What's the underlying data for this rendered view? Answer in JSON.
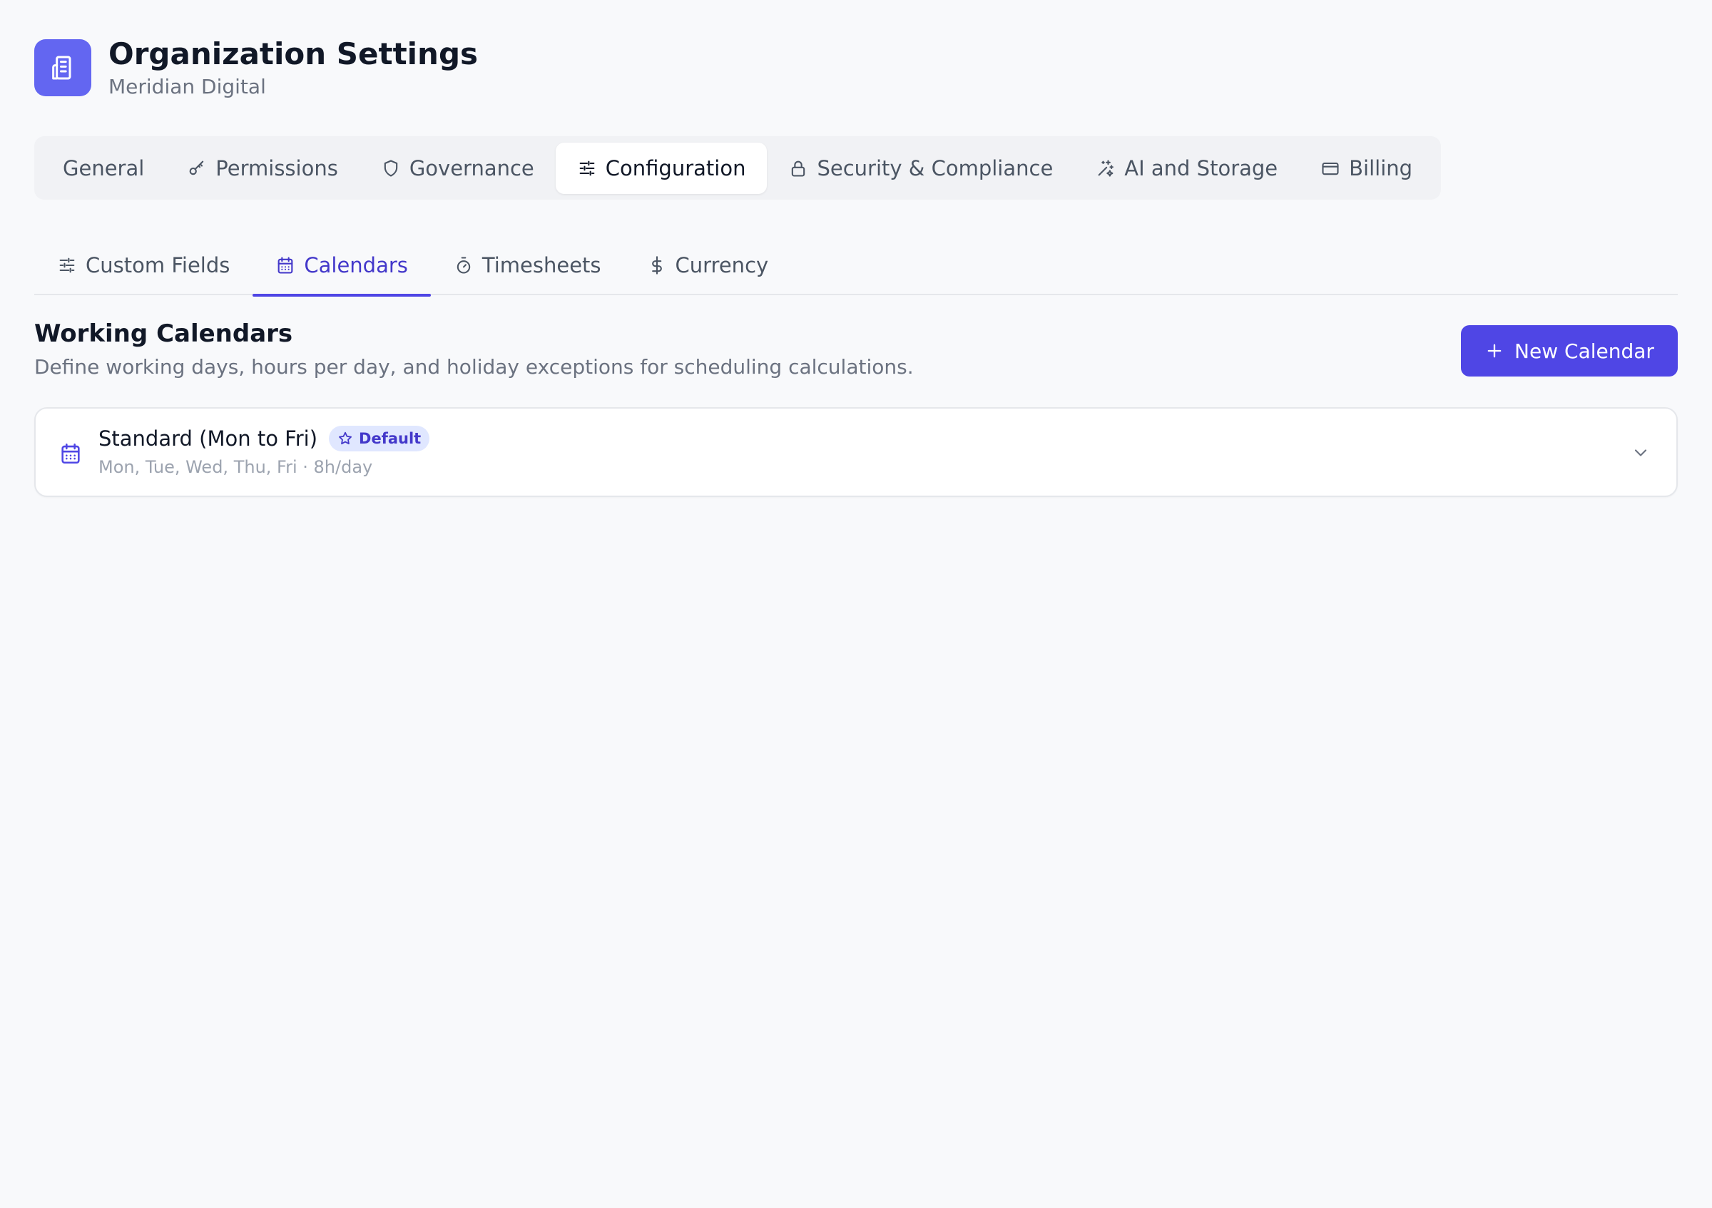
{
  "header": {
    "title": "Organization Settings",
    "subtitle": "Meridian Digital",
    "logo_icon": "building-icon"
  },
  "primary_tabs": [
    {
      "label": "General",
      "icon": null,
      "active": false
    },
    {
      "label": "Permissions",
      "icon": "key-icon",
      "active": false
    },
    {
      "label": "Governance",
      "icon": "shield-icon",
      "active": false
    },
    {
      "label": "Configuration",
      "icon": "sliders-icon",
      "active": true
    },
    {
      "label": "Security & Compliance",
      "icon": "lock-icon",
      "active": false
    },
    {
      "label": "AI and Storage",
      "icon": "sparkles-icon",
      "active": false
    },
    {
      "label": "Billing",
      "icon": "credit-card-icon",
      "active": false
    }
  ],
  "sub_tabs": [
    {
      "label": "Custom Fields",
      "icon": "sliders-icon",
      "active": false
    },
    {
      "label": "Calendars",
      "icon": "calendar-icon",
      "active": true
    },
    {
      "label": "Timesheets",
      "icon": "timer-icon",
      "active": false
    },
    {
      "label": "Currency",
      "icon": "dollar-icon",
      "active": false
    }
  ],
  "section": {
    "title": "Working Calendars",
    "description": "Define working days, hours per day, and holiday exceptions for scheduling calculations.",
    "new_button_label": "New Calendar"
  },
  "calendars": [
    {
      "name": "Standard (Mon to Fri)",
      "badge": "Default",
      "meta": "Mon, Tue, Wed, Thu, Fri · 8h/day",
      "expanded": false
    }
  ],
  "colors": {
    "accent": "#4f46e5",
    "accent_text": "#4338ca",
    "logo_bg": "#6366f1",
    "badge_bg": "#e0e7ff",
    "page_bg": "#f8f9fb"
  }
}
